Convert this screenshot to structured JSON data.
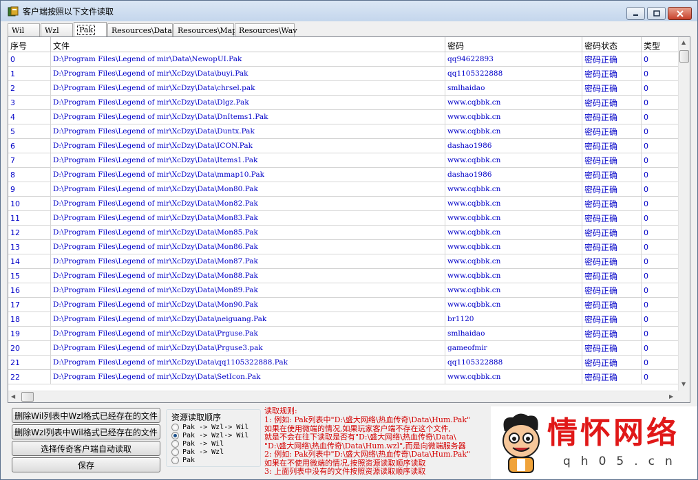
{
  "window": {
    "title": "客户端按照以下文件读取",
    "minimize_label": "",
    "maximize_label": "",
    "close_label": ""
  },
  "tabs": [
    {
      "label": "Wil"
    },
    {
      "label": "Wzl"
    },
    {
      "label": "Pak",
      "active": true
    },
    {
      "label": "Resources\\Data"
    },
    {
      "label": "Resources\\Map"
    },
    {
      "label": "Resources\\Wav"
    }
  ],
  "table": {
    "columns": [
      "序号",
      "文件",
      "密码",
      "密码状态",
      "类型"
    ],
    "rows": [
      [
        "0",
        "D:\\Program Files\\Legend of mir\\Data\\NewopUI.Pak",
        "qq94622893",
        "密码正确",
        "0"
      ],
      [
        "1",
        "D:\\Program Files\\Legend of mir\\XcDzy\\Data\\buyi.Pak",
        "qq1105322888",
        "密码正确",
        "0"
      ],
      [
        "2",
        "D:\\Program Files\\Legend of mir\\XcDzy\\Data\\chrsel.pak",
        "smlhaidao",
        "密码正确",
        "0"
      ],
      [
        "3",
        "D:\\Program Files\\Legend of mir\\XcDzy\\Data\\Dlgz.Pak",
        "www.cqbbk.cn",
        "密码正确",
        "0"
      ],
      [
        "4",
        "D:\\Program Files\\Legend of mir\\XcDzy\\Data\\DnItems1.Pak",
        "www.cqbbk.cn",
        "密码正确",
        "0"
      ],
      [
        "5",
        "D:\\Program Files\\Legend of mir\\XcDzy\\Data\\Duntx.Pak",
        "www.cqbbk.cn",
        "密码正确",
        "0"
      ],
      [
        "6",
        "D:\\Program Files\\Legend of mir\\XcDzy\\Data\\ICON.Pak",
        "dashao1986",
        "密码正确",
        "0"
      ],
      [
        "7",
        "D:\\Program Files\\Legend of mir\\XcDzy\\Data\\Items1.Pak",
        "www.cqbbk.cn",
        "密码正确",
        "0"
      ],
      [
        "8",
        "D:\\Program Files\\Legend of mir\\XcDzy\\Data\\mmap10.Pak",
        "dashao1986",
        "密码正确",
        "0"
      ],
      [
        "9",
        "D:\\Program Files\\Legend of mir\\XcDzy\\Data\\Mon80.Pak",
        "www.cqbbk.cn",
        "密码正确",
        "0"
      ],
      [
        "10",
        "D:\\Program Files\\Legend of mir\\XcDzy\\Data\\Mon82.Pak",
        "www.cqbbk.cn",
        "密码正确",
        "0"
      ],
      [
        "11",
        "D:\\Program Files\\Legend of mir\\XcDzy\\Data\\Mon83.Pak",
        "www.cqbbk.cn",
        "密码正确",
        "0"
      ],
      [
        "12",
        "D:\\Program Files\\Legend of mir\\XcDzy\\Data\\Mon85.Pak",
        "www.cqbbk.cn",
        "密码正确",
        "0"
      ],
      [
        "13",
        "D:\\Program Files\\Legend of mir\\XcDzy\\Data\\Mon86.Pak",
        "www.cqbbk.cn",
        "密码正确",
        "0"
      ],
      [
        "14",
        "D:\\Program Files\\Legend of mir\\XcDzy\\Data\\Mon87.Pak",
        "www.cqbbk.cn",
        "密码正确",
        "0"
      ],
      [
        "15",
        "D:\\Program Files\\Legend of mir\\XcDzy\\Data\\Mon88.Pak",
        "www.cqbbk.cn",
        "密码正确",
        "0"
      ],
      [
        "16",
        "D:\\Program Files\\Legend of mir\\XcDzy\\Data\\Mon89.Pak",
        "www.cqbbk.cn",
        "密码正确",
        "0"
      ],
      [
        "17",
        "D:\\Program Files\\Legend of mir\\XcDzy\\Data\\Mon90.Pak",
        "www.cqbbk.cn",
        "密码正确",
        "0"
      ],
      [
        "18",
        "D:\\Program Files\\Legend of mir\\XcDzy\\Data\\neiguang.Pak",
        "br1120",
        "密码正确",
        "0"
      ],
      [
        "19",
        "D:\\Program Files\\Legend of mir\\XcDzy\\Data\\Prguse.Pak",
        "smlhaidao",
        "密码正确",
        "0"
      ],
      [
        "20",
        "D:\\Program Files\\Legend of mir\\XcDzy\\Data\\Prguse3.pak",
        "gameofmir",
        "密码正确",
        "0"
      ],
      [
        "21",
        "D:\\Program Files\\Legend of mir\\XcDzy\\Data\\qq1105322888.Pak",
        "qq1105322888",
        "密码正确",
        "0"
      ],
      [
        "22",
        "D:\\Program Files\\Legend of mir\\XcDzy\\Data\\SetIcon.Pak",
        "www.cqbbk.cn",
        "密码正确",
        "0"
      ]
    ]
  },
  "buttons": {
    "delete_wil": "删除Wil列表中Wzl格式已经存在的文件",
    "delete_wzl": "删除Wzl列表中Wil格式已经存在的文件",
    "select_client": "选择传奇客户端自动读取",
    "save": "保存"
  },
  "read_order": {
    "title": "资源读取顺序",
    "options": [
      {
        "label": "Pak -> Wzl-> Wil",
        "selected": false
      },
      {
        "label": "Pak -> Wzl-> Wil",
        "selected": true
      },
      {
        "label": "Pak -> Wil",
        "selected": false
      },
      {
        "label": "Pak -> Wzl",
        "selected": false
      },
      {
        "label": "Pak",
        "selected": false
      }
    ]
  },
  "rules": {
    "title": "读取规则:",
    "lines": [
      "1: 例如: Pak列表中\"D:\\盛大网络\\热血传奇\\Data\\Hum.Pak\"",
      "   如果在使用微端的情况,如果玩家客户端不存在这个文件,",
      "   就是不会在往下读取是否有\"D:\\盛大网络\\热血传奇\\Data\\",
      "   \"D:\\盛大网络\\热血传奇\\Data\\Hum.wzl\",而是向微端服务器",
      "2: 例如: Pak列表中\"D:\\盛大网络\\热血传奇\\Data\\Hum.Pak\"",
      "   如果在不使用微端的情况,按照资源读取顺序读取",
      "3: 上面列表中没有的文件按照资源读取顺序读取"
    ]
  },
  "logo": {
    "text": "情怀网络",
    "sub": "qh05.cn",
    "colors": {
      "red": "#e01818",
      "gray": "#3a3a3a"
    }
  },
  "colors": {
    "link_blue": "#0000c8",
    "rule_red": "#d40000",
    "window_bg": "#f0f0f0"
  }
}
